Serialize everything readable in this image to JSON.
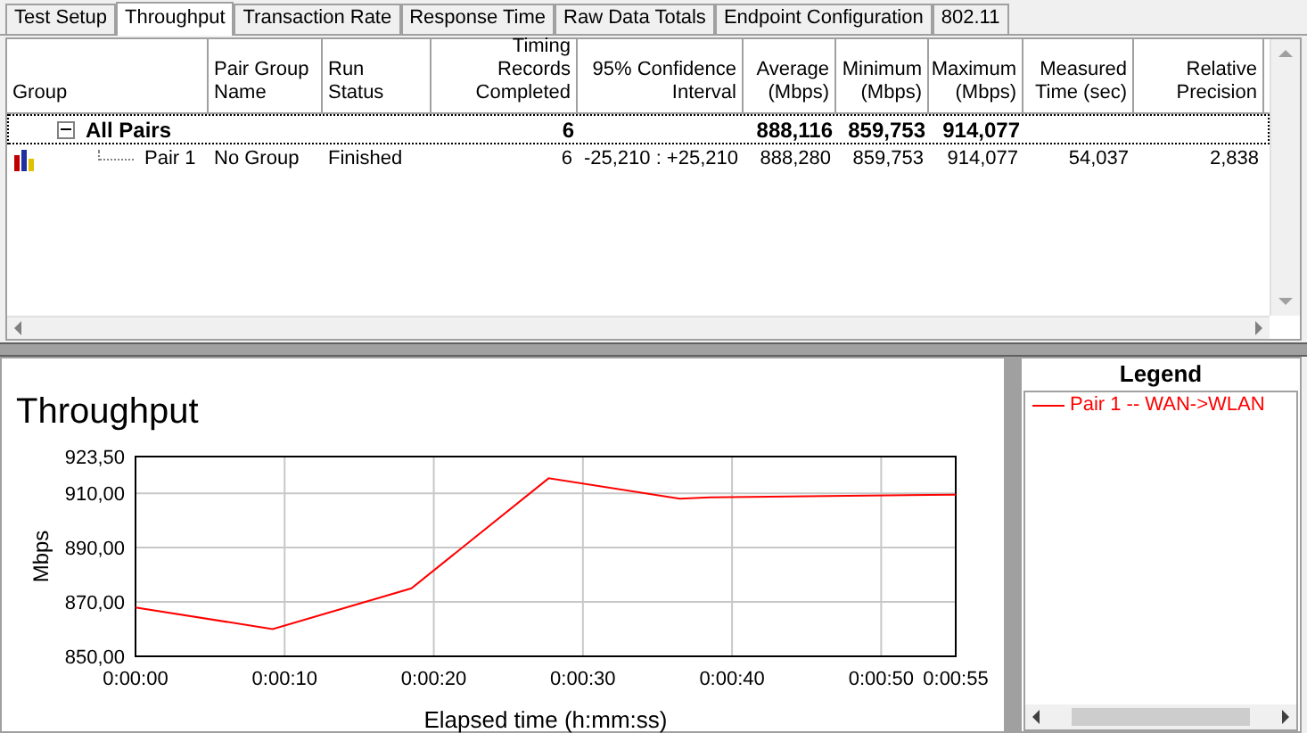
{
  "tabs": [
    {
      "label": "Test Setup",
      "selected": false
    },
    {
      "label": "Throughput",
      "selected": true
    },
    {
      "label": "Transaction Rate",
      "selected": false
    },
    {
      "label": "Response Time",
      "selected": false
    },
    {
      "label": "Raw Data Totals",
      "selected": false
    },
    {
      "label": "Endpoint Configuration",
      "selected": false
    },
    {
      "label": "802.11",
      "selected": false
    }
  ],
  "table": {
    "columns": [
      {
        "label": "Group"
      },
      {
        "label": "Pair Group Name"
      },
      {
        "label": "Run Status"
      },
      {
        "label": "Timing Records Completed"
      },
      {
        "label": "95% Confidence Interval"
      },
      {
        "label": "Average (Mbps)"
      },
      {
        "label": "Minimum (Mbps)"
      },
      {
        "label": "Maximum (Mbps)"
      },
      {
        "label": "Measured Time (sec)"
      },
      {
        "label": "Relative Precision"
      }
    ],
    "rows": [
      {
        "kind": "group",
        "expanded": true,
        "cells": [
          "All Pairs",
          "",
          "",
          "6",
          "",
          "888,116",
          "859,753",
          "914,077",
          "",
          ""
        ]
      },
      {
        "kind": "pair",
        "cells": [
          "Pair 1",
          "No Group",
          "Finished",
          "6",
          "-25,210 : +25,210",
          "888,280",
          "859,753",
          "914,077",
          "54,037",
          "2,838"
        ]
      }
    ]
  },
  "chart": {
    "chart_data": {
      "type": "line",
      "grid": true,
      "title": "Throughput",
      "xlabel": "Elapsed time (h:mm:ss)",
      "ylabel": "Mbps",
      "xlim": [
        0,
        55
      ],
      "ylim": [
        850,
        923.5
      ],
      "xticks": [
        {
          "value": 0,
          "label": "0:00:00"
        },
        {
          "value": 10,
          "label": "0:00:10"
        },
        {
          "value": 20,
          "label": "0:00:20"
        },
        {
          "value": 30,
          "label": "0:00:30"
        },
        {
          "value": 40,
          "label": "0:00:40"
        },
        {
          "value": 50,
          "label": "0:00:50"
        },
        {
          "value": 55,
          "label": "0:00:55"
        }
      ],
      "yticks": [
        {
          "value": 850,
          "label": "850,00"
        },
        {
          "value": 870,
          "label": "870,00"
        },
        {
          "value": 890,
          "label": "890,00"
        },
        {
          "value": 910,
          "label": "910,00"
        },
        {
          "value": 923.5,
          "label": "923,50"
        }
      ],
      "x": [
        0,
        9.2,
        18.5,
        27.7,
        36.5,
        38.5,
        55
      ],
      "series": [
        {
          "name": "Pair 1 -- WAN->WLAN",
          "color": "#ff0000",
          "values": [
            868,
            860,
            875,
            915.5,
            908,
            908.5,
            909.5
          ]
        }
      ]
    }
  },
  "legend": {
    "title": "Legend"
  }
}
